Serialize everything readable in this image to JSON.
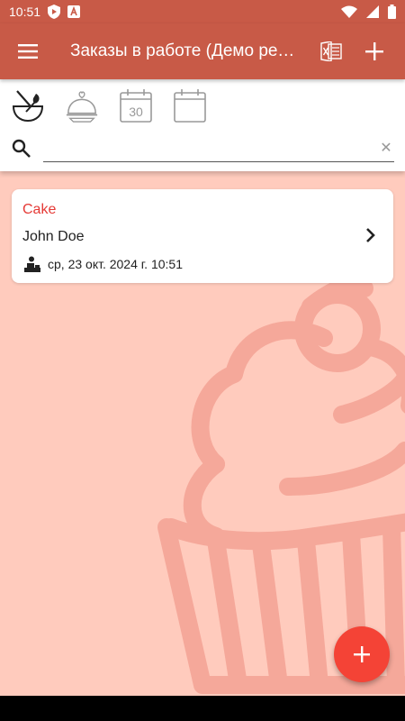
{
  "status_bar": {
    "time": "10:51"
  },
  "app_bar": {
    "title": "Заказы в работе (Демо режим)",
    "icons": [
      "menu-icon",
      "excel-icon",
      "add-icon"
    ]
  },
  "filters": {
    "icons": [
      "cooking-bowl-icon",
      "serving-cloche-icon",
      "calendar-30-icon",
      "calendar-icon"
    ],
    "calendar_day": "30"
  },
  "search": {
    "value": "",
    "placeholder": ""
  },
  "orders": [
    {
      "product": "Cake",
      "customer": "John Doe",
      "date": "ср, 23 окт. 2024 г. 10:51"
    }
  ],
  "colors": {
    "primary": "#c85a47",
    "background": "#ffcbbd",
    "accent": "#f44336",
    "product_text": "#e53935"
  }
}
